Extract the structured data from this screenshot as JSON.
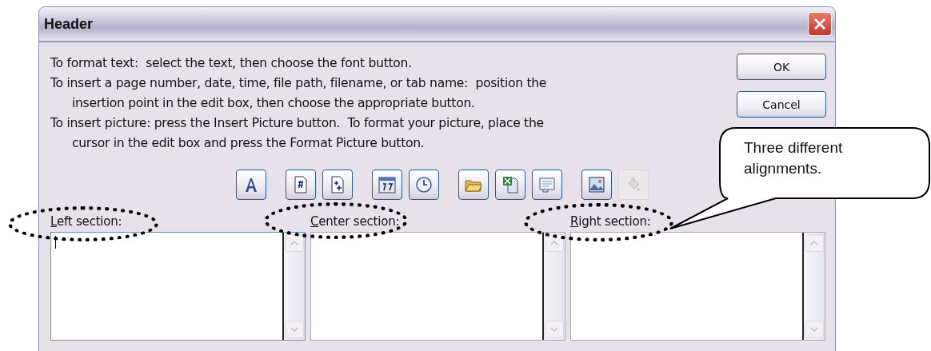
{
  "window": {
    "title": "Header"
  },
  "instructions": [
    "To format text:  select the text, then choose the font button.",
    "To insert a page number, date, time, file path, filename, or tab name:  position the insertion point in the edit box, then choose the appropriate button.",
    "To insert picture: press the Insert Picture button.  To format your picture, place the cursor in the edit box and press the Format Picture button."
  ],
  "buttons": [
    {
      "label": "OK"
    },
    {
      "label": "Cancel"
    }
  ],
  "toolbar": [
    [
      {
        "kind": "font",
        "disabled": false
      }
    ],
    [
      {
        "kind": "page-number",
        "disabled": false
      },
      {
        "kind": "page-count",
        "disabled": false
      }
    ],
    [
      {
        "kind": "date",
        "disabled": false
      },
      {
        "kind": "time",
        "disabled": false
      }
    ],
    [
      {
        "kind": "file-path",
        "disabled": false
      },
      {
        "kind": "filename",
        "disabled": false
      },
      {
        "kind": "sheet-name",
        "disabled": false
      }
    ],
    [
      {
        "kind": "picture",
        "disabled": false
      },
      {
        "kind": "format-picture",
        "disabled": true
      }
    ]
  ],
  "sections": [
    {
      "label": "Left section:",
      "focused": true,
      "highlighted": true
    },
    {
      "label": "Center section:",
      "focused": false,
      "highlighted": true
    },
    {
      "label": "Right section:",
      "focused": false,
      "highlighted": true
    }
  ],
  "callout": {
    "text": "Three different alignments."
  }
}
